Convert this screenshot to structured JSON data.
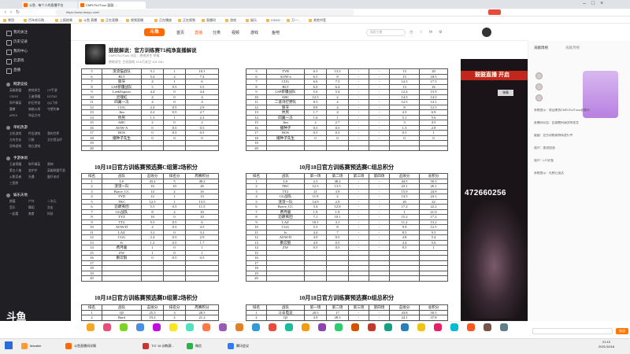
{
  "browser": {
    "tabs": [
      {
        "label": "斗鱼 - 每个人的直播平台",
        "active": false
      },
      {
        "label": "CMRJToJTuuu 鼓鼓 ...",
        "active": true
      }
    ],
    "url": "https://www.douyu.com/",
    "bookmarks": [
      "常用",
      "百年欢乐购 ...",
      "上报结果",
      "斗鱼 直播",
      "正在直播 ...",
      "视频直播",
      "正在播放",
      "正在视频",
      "直播间",
      "游戏",
      "娱乐",
      "CSGO",
      "万一...",
      "其他书签"
    ]
  },
  "sidebar": {
    "nav": [
      "我的关注",
      "历史记录",
      "我的中心",
      "云游戏",
      "直播"
    ],
    "groups": [
      {
        "title": "网游竞技",
        "items": [
          "英雄联盟",
          "绝地求生",
          "CF手游",
          "CSGO",
          "王者荣耀",
          "DOTA2",
          "和平精英",
          "炉石传说",
          "QQ飞车",
          "魔兽",
          "穿越火线",
          "守望先锋",
          "APEX",
          "命运方舟"
        ]
      },
      {
        "title": "单机热游",
        "items": [
          "主机游戏",
          "怀旧游戏",
          "我的世界",
          "方舟生存",
          "只狼",
          "艾尔登法环",
          "恐怖游戏",
          "独立游戏"
        ]
      },
      {
        "title": "手游休闲",
        "items": [
          "王者荣耀",
          "和平精英",
          "原神",
          "第五人格",
          "金铲铲",
          "英雄联盟手游",
          "火影忍者",
          "光遇",
          "蛋仔派对",
          "三国杀"
        ]
      },
      {
        "title": "娱乐天地",
        "items": [
          "颜值",
          "户外",
          "二次元",
          "音乐",
          "舞蹈",
          "交友",
          "一起看",
          "美食",
          "科技"
        ]
      }
    ],
    "logo": "斗鱼"
  },
  "site_nav": {
    "logo": "斗鱼",
    "items": [
      "首页",
      "直播",
      "分类",
      "视频",
      "游戏",
      "鱼吧"
    ],
    "active": "直播",
    "search_placeholder": "搜索主播"
  },
  "room": {
    "title": "鼓鼓解说：官方训练赛T1纯净直播解说",
    "meta": "CMRJToJTuuu  分区：绝地求生  举报",
    "tags": "绝地求生  主机游戏  19.6万关注  101  24h"
  },
  "standings": {
    "headers": [
      "排名",
      "战队",
      "击败分",
      "排名分",
      "周赛积分"
    ],
    "titles": [
      "10月18日官方训练赛预选赛C组第2场积分",
      "10月18日官方训练赛预选赛C组总积分",
      "10月18日官方训练赛预选赛D组第2场积分",
      "10月18日官方训练赛预选赛D组总积分"
    ],
    "top_left": [
      [
        "5",
        "渣渣猫战队",
        "5.1",
        "1",
        "10.1"
      ],
      [
        "6",
        "BLT",
        "5.4",
        "2",
        "7.4"
      ],
      [
        "7",
        "狼牙",
        "4",
        "1",
        "6"
      ],
      [
        "8",
        "LSP新疆战队",
        "5",
        "0.5",
        "5.5"
      ],
      [
        "9",
        "LeekEsports",
        "4.4",
        "0",
        "4.4"
      ],
      [
        "10",
        "灵魂虹",
        "4",
        "0",
        "4"
      ],
      [
        "11",
        "四翼一冻",
        "4",
        "0",
        "4"
      ],
      [
        "12",
        "CUG",
        "2.4",
        "0.5",
        "2.9"
      ],
      [
        "13",
        "Jim",
        "2.2",
        "0.5",
        "2.7"
      ],
      [
        "14",
        "杭男",
        "1.3",
        "1",
        "2.3"
      ],
      [
        "15",
        "ARC",
        "2",
        "0",
        "2"
      ],
      [
        "16",
        "AOW-A",
        "0",
        "0.5",
        "0.5"
      ],
      [
        "17",
        "BOS",
        "0",
        "0.5",
        "0.5"
      ],
      [
        "18",
        "播种子先生",
        "0",
        "0",
        "0"
      ],
      [
        "19",
        "",
        "",
        "",
        ""
      ],
      [
        "20",
        "",
        "",
        "",
        ""
      ]
    ],
    "top_right": [
      [
        "5",
        "TYR",
        "6.5",
        "13.5",
        "-",
        "-",
        "13",
        "20"
      ],
      [
        "6",
        "AOW-a",
        "6.5",
        "8",
        "-",
        "-",
        "15",
        "18.5"
      ],
      [
        "7",
        "CUG",
        "6.6",
        "7.5",
        "-",
        "-",
        "14.5",
        "17.5"
      ],
      [
        "8",
        "BLT",
        "6.0",
        "6.4",
        "-",
        "-",
        "13",
        "16"
      ],
      [
        "9",
        "LSP新疆战队",
        "5.0",
        "5.4",
        "-",
        "-",
        "12.4",
        "15.9"
      ],
      [
        "10",
        "ARC",
        "12.5",
        "2",
        "-",
        "-",
        "14.5",
        "14.5"
      ],
      [
        "11",
        "二道湾打野队",
        "8.5",
        "4",
        "-",
        "-",
        "12.5",
        "14.1"
      ],
      [
        "12",
        "狼牙",
        "8.8",
        "4",
        "-",
        "-",
        "8",
        "12.5"
      ],
      [
        "13",
        "杭男",
        "1.7",
        "4",
        "-",
        "-",
        "4.3",
        "6.9"
      ],
      [
        "14",
        "四翼一冻",
        "1.6",
        "1",
        "-",
        "-",
        "5.1",
        "5.6"
      ],
      [
        "15",
        "Jim",
        "2",
        "2.7",
        "-",
        "-",
        "3",
        "4.5"
      ],
      [
        "16",
        "播种子",
        "0.5",
        "0.5",
        "-",
        "-",
        "1.3",
        "2.8"
      ],
      [
        "17",
        "BOS",
        "0.5",
        "0.5",
        "-",
        "-",
        "0.5",
        "1"
      ],
      [
        "18",
        "播种子先生",
        "0",
        "0",
        "-",
        "-",
        "0",
        "0"
      ],
      [
        "19",
        "",
        "",
        "",
        "",
        "",
        "",
        ""
      ],
      [
        "20",
        "",
        "",
        "",
        "",
        "",
        "",
        ""
      ]
    ],
    "mid_left": [
      [
        "1",
        "LS",
        "43.2",
        "5",
        "48.2"
      ],
      [
        "2",
        "渣渣一队",
        "16",
        "10",
        "26"
      ],
      [
        "3",
        "Brave_CC",
        "14",
        "2",
        "16"
      ],
      [
        "4",
        "TYD",
        "12",
        "1",
        "13"
      ],
      [
        "5",
        "TKC",
        "12.5",
        "1",
        "13.5"
      ],
      [
        "6",
        "迈巅夷团",
        "5.5",
        "0.5",
        "11.5"
      ],
      [
        "7",
        "GG战队",
        "8",
        "2",
        "10"
      ],
      [
        "8",
        "TYZ",
        "10",
        "0",
        "10"
      ],
      [
        "9",
        "TT2",
        "5.5",
        "0.5",
        "6"
      ],
      [
        "10",
        "AOW-D",
        "4",
        "0.5",
        "4.5"
      ],
      [
        "11",
        "LAZ",
        "3.2",
        "0",
        "3.2"
      ],
      [
        "12",
        "CGG",
        "2.4",
        "0.5",
        "2.9"
      ],
      [
        "13",
        "Iv",
        "1.2",
        "0.5",
        "1.7"
      ],
      [
        "14",
        "费月媛",
        "1",
        "0",
        "1"
      ],
      [
        "15",
        "ZW",
        "1",
        "0",
        "1"
      ],
      [
        "16",
        "鹏云狼",
        "0",
        "0.5",
        "0.5"
      ],
      [
        "17",
        "",
        "",
        "",
        ""
      ],
      [
        "18",
        "",
        "",
        "",
        ""
      ],
      [
        "19",
        "",
        "",
        "",
        ""
      ],
      [
        "20",
        "",
        "",
        "",
        ""
      ]
    ],
    "mid_right_headers": [
      "排名",
      "战队",
      "第一场",
      "第二场",
      "第三场",
      "第四场",
      "击败分",
      "总积分"
    ],
    "mid_right": [
      [
        "1",
        "LS",
        "2.3",
        "48.2",
        "-",
        "-",
        "44.5",
        "50.5"
      ],
      [
        "2",
        "TKC",
        "12.5",
        "13.5",
        "-",
        "-",
        "23.1",
        "26.1"
      ],
      [
        "3",
        "TT2",
        "21",
        "3.9",
        "-",
        "-",
        "15.9",
        "24.9"
      ],
      [
        "4",
        "GG战队",
        "11.9",
        "2",
        "-",
        "-",
        "14.5",
        "24.1"
      ],
      [
        "5",
        "渣渣一队",
        "14.9",
        "2.9",
        "-",
        "-",
        "20",
        "22"
      ],
      [
        "6",
        "Brave_CC",
        "5.4",
        "12.8",
        "-",
        "-",
        "17.2",
        "22.2"
      ],
      [
        "7",
        "费月媛",
        "1.9",
        "1.9",
        "-",
        "-",
        "1",
        "21.0"
      ],
      [
        "8",
        "迈巅夷团",
        "7.1",
        "10.1",
        "-",
        "-",
        "15.2",
        "17.2"
      ],
      [
        "9",
        "LAZ",
        "10.1",
        "3.1",
        "-",
        "-",
        "11.2",
        "13.2"
      ],
      [
        "10",
        "CGG",
        "5.5",
        "8",
        "-",
        "-",
        "9.9",
        "12.5"
      ],
      [
        "11",
        "Iv",
        "4.4",
        "7",
        "-",
        "-",
        "8.5",
        "9.5"
      ],
      [
        "12",
        "AOW-D",
        "4.9",
        "0.5",
        "-",
        "-",
        "4.8",
        "5.4"
      ],
      [
        "13",
        "鹏云狼",
        "4.9",
        "0.5",
        "-",
        "-",
        "4.4",
        "5.6"
      ],
      [
        "14",
        "ZW",
        "0.5",
        "0.5",
        "-",
        "-",
        "0.5",
        "1"
      ],
      [
        "15",
        "",
        "",
        "",
        "",
        "",
        "",
        ""
      ],
      [
        "16",
        "",
        "",
        "",
        "",
        "",
        "",
        ""
      ],
      [
        "17",
        "",
        "",
        "",
        "",
        "",
        "",
        ""
      ],
      [
        "18",
        "",
        "",
        "",
        "",
        "",
        "",
        ""
      ],
      [
        "19",
        "",
        "",
        "",
        "",
        "",
        "",
        ""
      ],
      [
        "20",
        "",
        "",
        "",
        "",
        "",
        "",
        ""
      ]
    ],
    "bottom_left": [
      [
        "1",
        "Q5",
        "25.5",
        "3",
        "28.5"
      ],
      [
        "2",
        "Bard",
        "19.2",
        "2",
        "21.2"
      ]
    ],
    "bottom_right": [
      [
        "1",
        "斗辛电竞",
        "20.5",
        "17",
        "-",
        "-",
        "43.8",
        "50.5"
      ],
      [
        "2",
        "Q5",
        "4.9",
        "28.5",
        "-",
        "-",
        "24.1",
        "37.8"
      ]
    ]
  },
  "video": {
    "banner": "鼓鼓直播 开启",
    "input_label": "弹幕",
    "room_number": "472660256"
  },
  "right_panel": {
    "tabs": [
      "贡献周榜",
      "贡献月榜"
    ],
    "chat": [
      "系统提示：欢迎来到CMRJToJTuuu直播间",
      "直播间公告：比赛期间请文明发言",
      "鼓鼓：官方训练赛持续进行中",
      "观众：加油加油",
      "观众：LS 好强",
      "系统提示：礼物已送达"
    ],
    "send_label": "发送"
  },
  "taskbar": {
    "apps": [
      {
        "label": "Marable",
        "color": "#ff9933"
      },
      {
        "label": "斗鱼直播间详情",
        "color": "#ff6a00"
      },
      {
        "label": "T07 18 训练赛...",
        "color": "#cc3333"
      },
      {
        "label": "微信",
        "color": "#2bb24c"
      },
      {
        "label": "腾讯会议",
        "color": "#2f7df6"
      }
    ],
    "time": "21:10",
    "date": "2021/10/18"
  }
}
